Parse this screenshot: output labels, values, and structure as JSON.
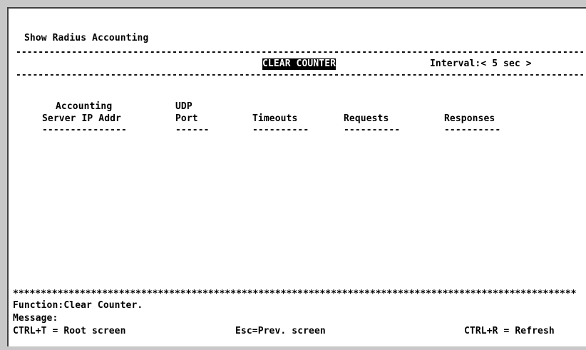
{
  "screen": {
    "title": "Show Radius Accounting",
    "separator": "------------------------------------------------------------------------------------------------------",
    "clear_counter_label": "CLEAR COUNTER",
    "interval_label": "Interval:< 5 sec >"
  },
  "table": {
    "headers": [
      {
        "line1": "Accounting",
        "line2": "Server IP Addr",
        "underline": "---------------"
      },
      {
        "line1": "UDP",
        "line2": "Port",
        "underline": "------"
      },
      {
        "line1": "",
        "line2": "Timeouts",
        "underline": "----------"
      },
      {
        "line1": "",
        "line2": "Requests",
        "underline": "----------"
      },
      {
        "line1": "",
        "line2": "Responses",
        "underline": "----------"
      }
    ]
  },
  "footer": {
    "stars": "*****************************************************************************************************",
    "function_text": "Function:Clear Counter.",
    "message_text": "Message:",
    "root_screen": "CTRL+T = Root screen",
    "prev_screen": "Esc=Prev. screen",
    "refresh": "CTRL+R = Refresh"
  }
}
